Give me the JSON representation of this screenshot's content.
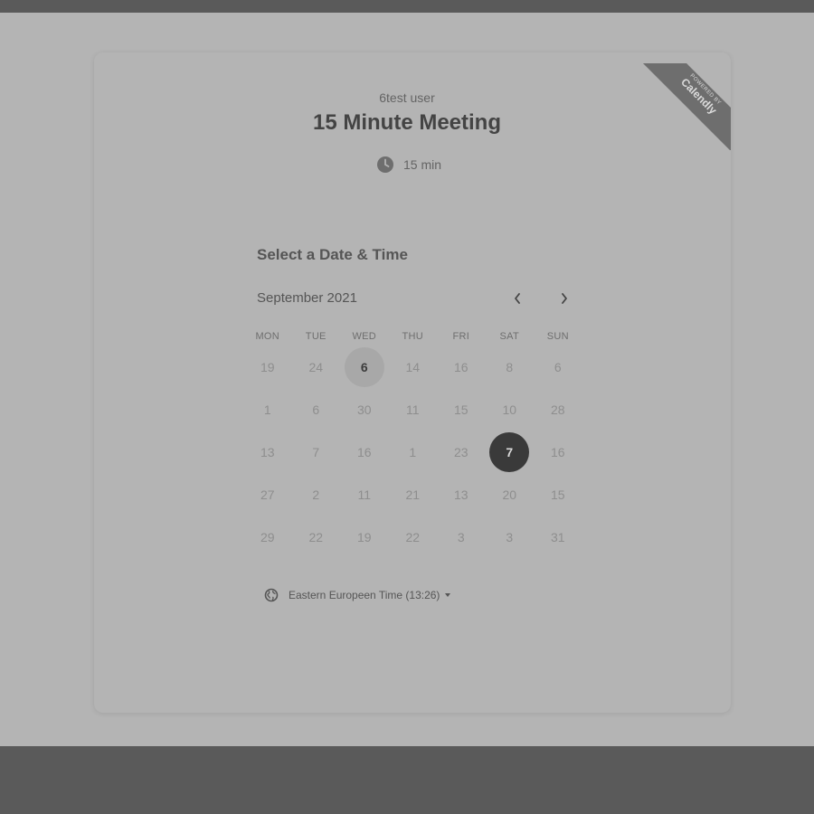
{
  "header": {
    "owner_name": "6test user",
    "event_title": "15 Minute Meeting",
    "duration_label": "15 min",
    "duration_icon": "clock-icon"
  },
  "ribbon": {
    "small_text": "POWERED BY",
    "brand": "Calendly"
  },
  "calendar": {
    "section_title": "Select a Date & Time",
    "month_label": "September 2021",
    "prev_icon": "chevron-left-icon",
    "next_icon": "chevron-right-icon",
    "weekdays": [
      "MON",
      "TUE",
      "WED",
      "THU",
      "FRI",
      "SAT",
      "SUN"
    ],
    "weeks": [
      [
        {
          "label": "19",
          "state": "disabled"
        },
        {
          "label": "24",
          "state": "disabled"
        },
        {
          "label": "6",
          "state": "available"
        },
        {
          "label": "14",
          "state": "disabled"
        },
        {
          "label": "16",
          "state": "disabled"
        },
        {
          "label": "8",
          "state": "disabled"
        },
        {
          "label": "6",
          "state": "disabled"
        }
      ],
      [
        {
          "label": "1",
          "state": "disabled"
        },
        {
          "label": "6",
          "state": "disabled"
        },
        {
          "label": "30",
          "state": "disabled"
        },
        {
          "label": "11",
          "state": "disabled"
        },
        {
          "label": "15",
          "state": "disabled"
        },
        {
          "label": "10",
          "state": "disabled"
        },
        {
          "label": "28",
          "state": "disabled"
        }
      ],
      [
        {
          "label": "13",
          "state": "disabled"
        },
        {
          "label": "7",
          "state": "disabled"
        },
        {
          "label": "16",
          "state": "disabled"
        },
        {
          "label": "1",
          "state": "disabled"
        },
        {
          "label": "23",
          "state": "disabled"
        },
        {
          "label": "7",
          "state": "selected"
        },
        {
          "label": "16",
          "state": "disabled"
        }
      ],
      [
        {
          "label": "27",
          "state": "disabled"
        },
        {
          "label": "2",
          "state": "disabled"
        },
        {
          "label": "11",
          "state": "disabled"
        },
        {
          "label": "21",
          "state": "disabled"
        },
        {
          "label": "13",
          "state": "disabled"
        },
        {
          "label": "20",
          "state": "disabled"
        },
        {
          "label": "15",
          "state": "disabled"
        }
      ],
      [
        {
          "label": "29",
          "state": "disabled"
        },
        {
          "label": "22",
          "state": "disabled"
        },
        {
          "label": "19",
          "state": "disabled"
        },
        {
          "label": "22",
          "state": "disabled"
        },
        {
          "label": "3",
          "state": "disabled"
        },
        {
          "label": "3",
          "state": "disabled"
        },
        {
          "label": "31",
          "state": "disabled"
        }
      ]
    ]
  },
  "timezone": {
    "label": "Eastern Europeen Time (13:26)",
    "icon": "globe-icon"
  },
  "colors": {
    "overlay": "#5a5a5a",
    "page_bg": "#b4b4b4",
    "selected_day": "#3a3a3a",
    "available_day": "#a8a8a8"
  }
}
